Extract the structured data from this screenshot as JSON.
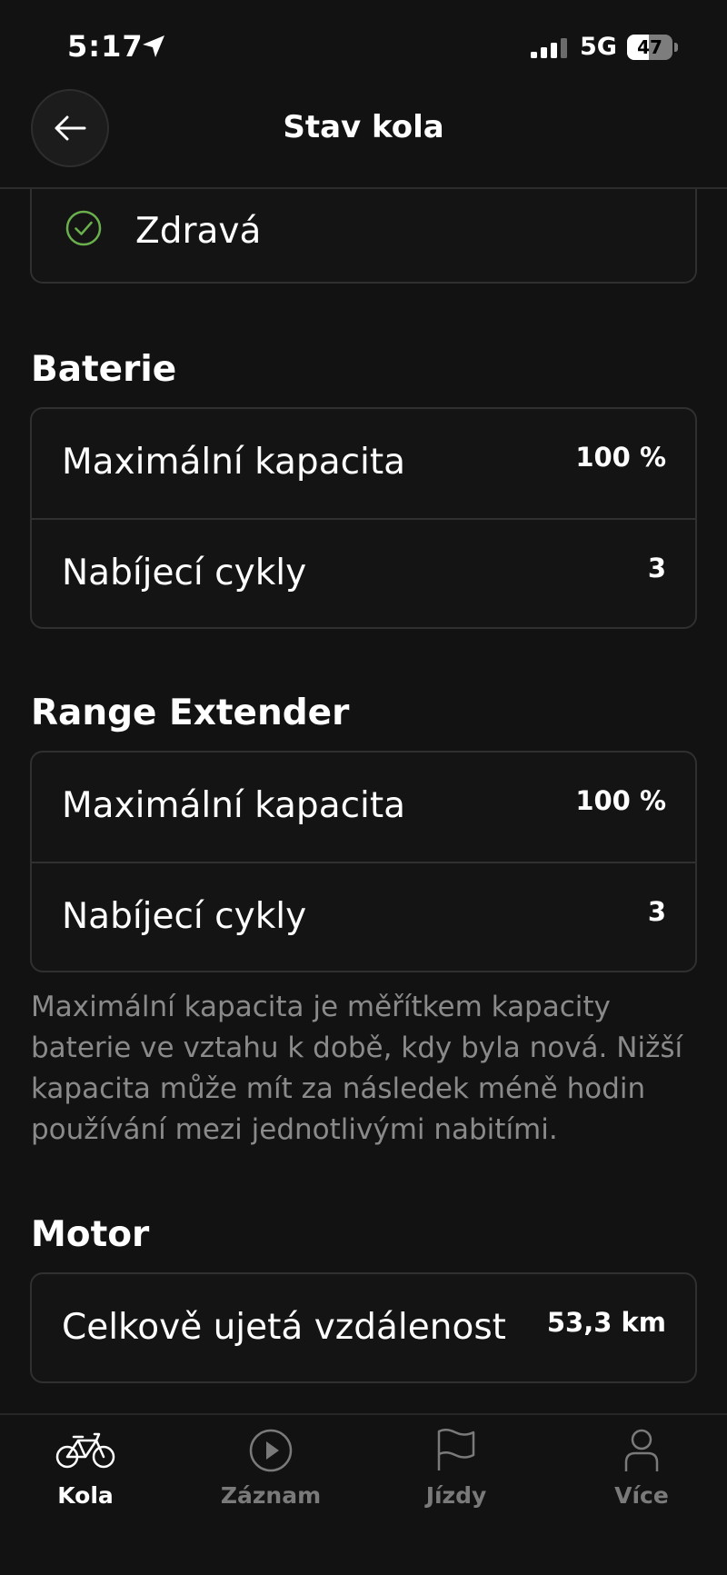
{
  "status_bar": {
    "time": "5:17",
    "network": "5G",
    "battery_level": "47",
    "battery_fraction": 0.47
  },
  "header": {
    "title": "Stav kola"
  },
  "health": {
    "status": "Zdravá",
    "status_color": "#6ab04c"
  },
  "battery": {
    "title": "Baterie",
    "rows": [
      {
        "label": "Maximální kapacita",
        "value": "100 %"
      },
      {
        "label": "Nabíjecí cykly",
        "value": "3"
      }
    ]
  },
  "range_extender": {
    "title": "Range Extender",
    "rows": [
      {
        "label": "Maximální kapacita",
        "value": "100 %"
      },
      {
        "label": "Nabíjecí cykly",
        "value": "3"
      }
    ]
  },
  "note": "Maximální kapacita je měřítkem kapacity baterie ve vztahu k době, kdy byla nová. Nižší kapacita může mít za následek méně hodin používání mezi jednotlivými nabitími.",
  "motor": {
    "title": "Motor",
    "rows": [
      {
        "label": "Celkově ujetá vzdálenost",
        "value": "53,3 km"
      }
    ]
  },
  "tabs": [
    {
      "label": "Kola",
      "icon": "bike-icon",
      "active": true
    },
    {
      "label": "Záznam",
      "icon": "play-icon",
      "active": false
    },
    {
      "label": "Jízdy",
      "icon": "flag-icon",
      "active": false
    },
    {
      "label": "Více",
      "icon": "person-icon",
      "active": false
    }
  ]
}
